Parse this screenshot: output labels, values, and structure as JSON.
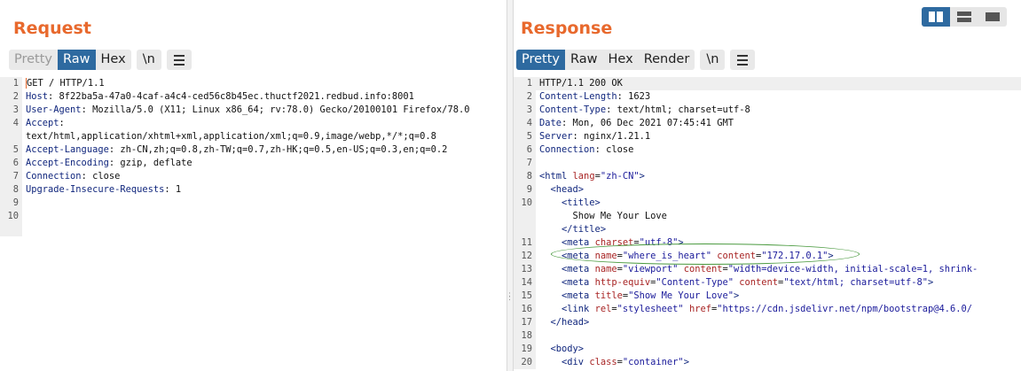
{
  "request": {
    "title": "Request",
    "tabs": [
      {
        "label": "Pretty",
        "state": "disabled"
      },
      {
        "label": "Raw",
        "state": "active"
      },
      {
        "label": "Hex",
        "state": "normal"
      }
    ],
    "newline_button": "\\n",
    "menu_icon": "hamburger-icon",
    "lines": [
      {
        "n": "1",
        "segs": [
          {
            "t": "GET / HTTP/1.1",
            "c": ""
          }
        ]
      },
      {
        "n": "2",
        "segs": [
          {
            "t": "Host",
            "c": "k"
          },
          {
            "t": ": 8f22ba5a-47a0-4caf-a4c4-ced56c8b45ec.thuctf2021.redbud.info:8001",
            "c": ""
          }
        ]
      },
      {
        "n": "3",
        "segs": [
          {
            "t": "User-Agent",
            "c": "k"
          },
          {
            "t": ": Mozilla/5.0 (X11; Linux x86_64; rv:78.0) Gecko/20100101 Firefox/78.0",
            "c": ""
          }
        ]
      },
      {
        "n": "4",
        "segs": [
          {
            "t": "Accept",
            "c": "k"
          },
          {
            "t": ":",
            "c": ""
          }
        ]
      },
      {
        "n": "",
        "segs": [
          {
            "t": "text/html,application/xhtml+xml,application/xml;q=0.9,image/webp,*/*;q=0.8",
            "c": ""
          }
        ]
      },
      {
        "n": "5",
        "segs": [
          {
            "t": "Accept-Language",
            "c": "k"
          },
          {
            "t": ": zh-CN,zh;q=0.8,zh-TW;q=0.7,zh-HK;q=0.5,en-US;q=0.3,en;q=0.2",
            "c": ""
          }
        ]
      },
      {
        "n": "6",
        "segs": [
          {
            "t": "Accept-Encoding",
            "c": "k"
          },
          {
            "t": ": gzip, deflate",
            "c": ""
          }
        ]
      },
      {
        "n": "7",
        "segs": [
          {
            "t": "Connection",
            "c": "k"
          },
          {
            "t": ": close",
            "c": ""
          }
        ]
      },
      {
        "n": "8",
        "segs": [
          {
            "t": "Upgrade-Insecure-Requests",
            "c": "k"
          },
          {
            "t": ": 1",
            "c": ""
          }
        ]
      },
      {
        "n": "9",
        "segs": []
      },
      {
        "n": "10",
        "segs": []
      },
      {
        "n": "",
        "segs": []
      }
    ]
  },
  "response": {
    "title": "Response",
    "tabs": [
      {
        "label": "Pretty",
        "state": "active"
      },
      {
        "label": "Raw",
        "state": "normal"
      },
      {
        "label": "Hex",
        "state": "normal"
      },
      {
        "label": "Render",
        "state": "normal"
      }
    ],
    "newline_button": "\\n",
    "menu_icon": "hamburger-icon",
    "lines": [
      {
        "n": "1",
        "hl": true,
        "segs": [
          {
            "t": "HTTP/1.1 200 OK",
            "c": ""
          }
        ]
      },
      {
        "n": "2",
        "segs": [
          {
            "t": "Content-Length",
            "c": "k"
          },
          {
            "t": ": 1623",
            "c": ""
          }
        ]
      },
      {
        "n": "3",
        "segs": [
          {
            "t": "Content-Type",
            "c": "k"
          },
          {
            "t": ": text/html; charset=utf-8",
            "c": ""
          }
        ]
      },
      {
        "n": "4",
        "segs": [
          {
            "t": "Date",
            "c": "k"
          },
          {
            "t": ": Mon, 06 Dec 2021 07:45:41 GMT",
            "c": ""
          }
        ]
      },
      {
        "n": "5",
        "segs": [
          {
            "t": "Server",
            "c": "k"
          },
          {
            "t": ": nginx/1.21.1",
            "c": ""
          }
        ]
      },
      {
        "n": "6",
        "segs": [
          {
            "t": "Connection",
            "c": "k"
          },
          {
            "t": ": close",
            "c": ""
          }
        ]
      },
      {
        "n": "7",
        "segs": []
      },
      {
        "n": "8",
        "segs": [
          {
            "t": "<html ",
            "c": "tag"
          },
          {
            "t": "lang",
            "c": "attr"
          },
          {
            "t": "=",
            "c": ""
          },
          {
            "t": "\"zh-CN\"",
            "c": "str"
          },
          {
            "t": ">",
            "c": "tag"
          }
        ]
      },
      {
        "n": "9",
        "segs": [
          {
            "t": "  <head>",
            "c": "tag"
          }
        ]
      },
      {
        "n": "10",
        "segs": [
          {
            "t": "    <title>",
            "c": "tag"
          }
        ]
      },
      {
        "n": "",
        "segs": [
          {
            "t": "      Show Me Your Love",
            "c": ""
          }
        ]
      },
      {
        "n": "",
        "segs": [
          {
            "t": "    </title>",
            "c": "tag"
          }
        ]
      },
      {
        "n": "11",
        "segs": [
          {
            "t": "    <meta ",
            "c": "tag"
          },
          {
            "t": "charset",
            "c": "attr"
          },
          {
            "t": "=",
            "c": ""
          },
          {
            "t": "\"utf-8\"",
            "c": "str"
          },
          {
            "t": ">",
            "c": "tag"
          }
        ]
      },
      {
        "n": "12",
        "segs": [
          {
            "t": "    <meta ",
            "c": "tag"
          },
          {
            "t": "name",
            "c": "attr"
          },
          {
            "t": "=",
            "c": ""
          },
          {
            "t": "\"where_is_heart\"",
            "c": "str"
          },
          {
            "t": " ",
            "c": ""
          },
          {
            "t": "content",
            "c": "attr"
          },
          {
            "t": "=",
            "c": ""
          },
          {
            "t": "\"172.17.0.1\"",
            "c": "str"
          },
          {
            "t": ">",
            "c": "tag"
          }
        ]
      },
      {
        "n": "13",
        "segs": [
          {
            "t": "    <meta ",
            "c": "tag"
          },
          {
            "t": "name",
            "c": "attr"
          },
          {
            "t": "=",
            "c": ""
          },
          {
            "t": "\"viewport\"",
            "c": "str"
          },
          {
            "t": " ",
            "c": ""
          },
          {
            "t": "content",
            "c": "attr"
          },
          {
            "t": "=",
            "c": ""
          },
          {
            "t": "\"width=device-width, initial-scale=1, shrink-",
            "c": "str"
          }
        ]
      },
      {
        "n": "14",
        "segs": [
          {
            "t": "    <meta ",
            "c": "tag"
          },
          {
            "t": "http-equiv",
            "c": "attr"
          },
          {
            "t": "=",
            "c": ""
          },
          {
            "t": "\"Content-Type\"",
            "c": "str"
          },
          {
            "t": " ",
            "c": ""
          },
          {
            "t": "content",
            "c": "attr"
          },
          {
            "t": "=",
            "c": ""
          },
          {
            "t": "\"text/html; charset=utf-8\"",
            "c": "str"
          },
          {
            "t": ">",
            "c": "tag"
          }
        ]
      },
      {
        "n": "15",
        "segs": [
          {
            "t": "    <meta ",
            "c": "tag"
          },
          {
            "t": "title",
            "c": "attr"
          },
          {
            "t": "=",
            "c": ""
          },
          {
            "t": "\"Show Me Your Love\"",
            "c": "str"
          },
          {
            "t": ">",
            "c": "tag"
          }
        ]
      },
      {
        "n": "16",
        "segs": [
          {
            "t": "    <link ",
            "c": "tag"
          },
          {
            "t": "rel",
            "c": "attr"
          },
          {
            "t": "=",
            "c": ""
          },
          {
            "t": "\"stylesheet\"",
            "c": "str"
          },
          {
            "t": " ",
            "c": ""
          },
          {
            "t": "href",
            "c": "attr"
          },
          {
            "t": "=",
            "c": ""
          },
          {
            "t": "\"https://cdn.jsdelivr.net/npm/bootstrap@4.6.0/",
            "c": "str"
          }
        ]
      },
      {
        "n": "17",
        "segs": [
          {
            "t": "  </head>",
            "c": "tag"
          }
        ]
      },
      {
        "n": "18",
        "segs": []
      },
      {
        "n": "19",
        "segs": [
          {
            "t": "  <body>",
            "c": "tag"
          }
        ]
      },
      {
        "n": "20",
        "segs": [
          {
            "t": "    <div ",
            "c": "tag"
          },
          {
            "t": "class",
            "c": "attr"
          },
          {
            "t": "=",
            "c": ""
          },
          {
            "t": "\"container\"",
            "c": "str"
          },
          {
            "t": ">",
            "c": "tag"
          }
        ]
      }
    ]
  },
  "layout_buttons": [
    {
      "icon": "side-by-side-icon",
      "active": true
    },
    {
      "icon": "stacked-rows-icon",
      "active": false
    },
    {
      "icon": "single-pane-icon",
      "active": false
    }
  ],
  "colors": {
    "accent": "#e8692d",
    "active_tab": "#2e6aa0",
    "annotation": "#4a9a3f"
  }
}
